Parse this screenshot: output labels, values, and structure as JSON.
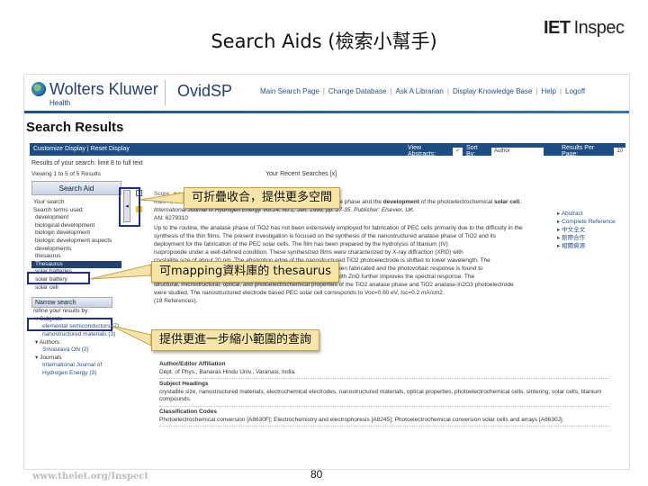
{
  "slide": {
    "title": "Search Aids (檢索小幫手)",
    "logo_iet": "IET",
    "logo_inspec": "Inspec",
    "footer_url": "www.theiet.org/Inspect",
    "page_number": "80"
  },
  "brand": {
    "company": "Wolters Kluwer",
    "division": "Health",
    "product": "OvidSP",
    "nav": [
      "Main Search Page",
      "Change Database",
      "Ask A Librarian",
      "Display Knowledge Base",
      "Help",
      "Logoff"
    ]
  },
  "page_heading": "Search Results",
  "toolbar": {
    "customize": "Customize Display | Reset Display",
    "view_abstracts_label": "View Abstracts:",
    "sort_by_label": "Sort By:",
    "sort_by_value": "Author",
    "results_per_page_label": "Results Per Page:",
    "results_per_page_value": "10"
  },
  "results_line": "Results of your search: limit 8 to full text",
  "viewing": "Viewing 1 to 5 of 5 Results",
  "recent_searches": "Your Recent Searches [x]",
  "sidebar": {
    "search_aid_title": "Search Aid",
    "your_search_label": "Your search",
    "search_terms_label": "Search terms used:",
    "terms": [
      "development",
      "biological development",
      "biologic development",
      "biologic development aspects",
      "developments"
    ],
    "terms_partial": "thesaurus",
    "thesaurus_link": "Thesaurus",
    "extra_terms": [
      "solar batteries",
      "solar battery",
      "solar cell"
    ],
    "narrow_title": "Narrow search",
    "refine_label": "refine your results by:",
    "subjects_label": "Subjects",
    "subjects": [
      "elemental semiconductors (7)",
      "nanostructured materials (3)"
    ],
    "authors_label": "Authors",
    "authors": [
      "Srivastava ON (2)"
    ],
    "journals_label": "Journals",
    "journals": [
      "International Journal of Hydrogen Energy (3)"
    ]
  },
  "collapse_control": "◂",
  "result": {
    "score_label": "Score:",
    "stars": "★★★★★",
    "authors": "Kant K, Srivastava ON.",
    "title_lead": "On the synthesis of nanostructured TiO2 anatase phase and the",
    "title_hl1": "development",
    "title_mid": "of the photoelectrochemical",
    "title_hl2": "solar cell",
    "title_end": ".",
    "source": "International Journal of Hydrogen Energy. vol.24, no.1, Jan. 1999, pp. 27-35. Publisher: Elsevier, UK.",
    "an": "AN: 6279310",
    "abstract_lines": [
      "Up to the routine, the anatase phase of TiO2 has not been extensively employed for fabrication of PEC cells primarily due to the difficulty in the",
      "synthesis of the thin films. The present investigation is focused on the synthesis of the nanostructured anatase phase of TiO2 and its",
      "deployment for the fabrication of the PEC solar cells. The film has been prepared by the hydrolysis of titanium (IV)",
      "isopropoxide under a well-defined condition. These synthesized films were characterized by X-ray diffraction (XRD) with",
      "crystallite size of about 20 nm. The absorption edge of the nanostructured TiO2 photoelectrode is shifted to lower wavelength. The",
      "PEC solar cells, having nanostructured TiO2 as photoelectrode, have been fabricated and the photovoltaic response is found to",
      "improve the spectral response. It has been found that addition of TiO2 with ZnO further improves the spectral response. The",
      "structural, microstructural, optical, and photoelectrochemical properties of the TiO2 anatase phase and TiO2 anatase-In2O3 photoelectrode",
      "were studied. The nanostructured electrode based PEC solar cell corresponds to Voc=0.60 eV, Isc=0.2 mA/cm2.",
      "(19 References)."
    ]
  },
  "right_links": [
    "Abstract",
    "Complete Reference",
    "中文全文",
    "館際合作",
    "相關資源"
  ],
  "meta": {
    "affiliation_label": "Author/Editor Affiliation",
    "affiliation": "Dept. of Phys., Banaras Hindu Univ., Varanasi, India.",
    "headings_label": "Subject Headings",
    "headings": "crystallite size, nanostructured materials, electrochemical electrodes, nanostructured materials, optical properties, photoelectrochemical cells, sintering, solar cells, titanium compounds.",
    "classification_label": "Classification Codes",
    "classification": "Photoelectrochemical conversion [A8630F]; Electrochemistry and electrophoresis [A8245]; Photoelectrochemical conversion solar cells and arrays [A8630J]."
  },
  "callouts": {
    "collapse": "可折疊收合，提供更多空間",
    "thesaurus": "可mapping資料庫的 thesaurus",
    "narrow": "提供更進一步縮小範圍的查詢"
  },
  "colors": {
    "brand_blue": "#1c4d86",
    "callout_bg": "#f6e5a9",
    "highlight_box": "#23307f"
  }
}
